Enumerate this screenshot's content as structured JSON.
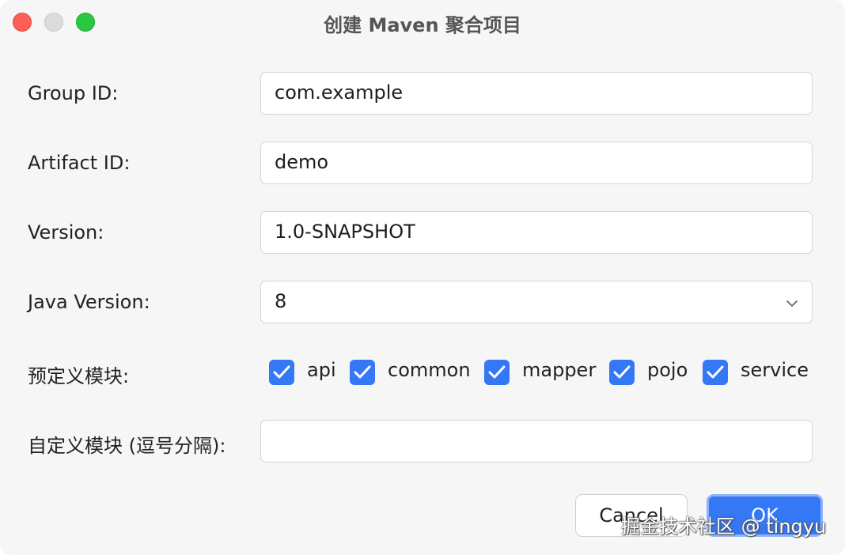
{
  "window": {
    "title": "创建 Maven 聚合项目"
  },
  "form": {
    "group_id": {
      "label": "Group ID:",
      "value": "com.example"
    },
    "artifact_id": {
      "label": "Artifact ID:",
      "value": "demo"
    },
    "version": {
      "label": "Version:",
      "value": "1.0-SNAPSHOT"
    },
    "java_version": {
      "label": "Java Version:",
      "selected": "8"
    },
    "predefined_modules": {
      "label": "预定义模块:",
      "options": [
        {
          "label": "api",
          "checked": true
        },
        {
          "label": "common",
          "checked": true
        },
        {
          "label": "mapper",
          "checked": true
        },
        {
          "label": "pojo",
          "checked": true
        },
        {
          "label": "service",
          "checked": true
        }
      ]
    },
    "custom_modules": {
      "label": "自定义模块 (逗号分隔):",
      "value": ""
    }
  },
  "buttons": {
    "cancel_label": "Cancel",
    "ok_label": "OK"
  },
  "watermark": "掘金技术社区 @ tingyu",
  "colors": {
    "accent": "#3478f6",
    "close": "#fe5f57",
    "maximize": "#28c840",
    "minimize": "#dcdcdc"
  }
}
